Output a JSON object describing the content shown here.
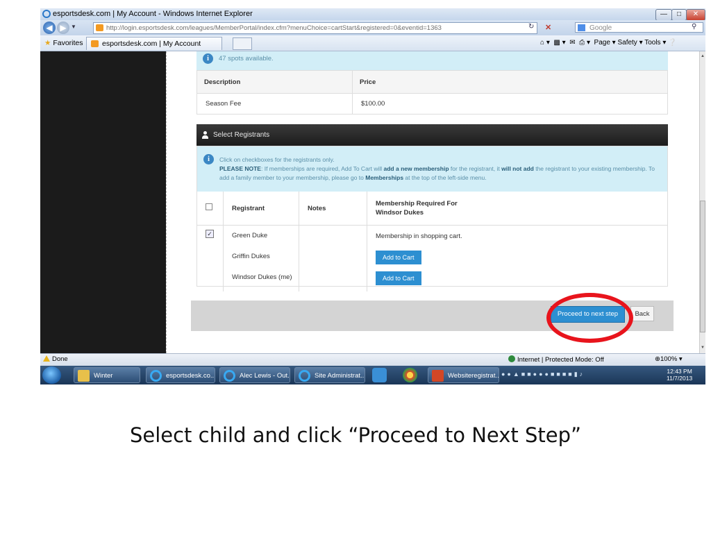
{
  "browser": {
    "title": "esportsdesk.com | My Account - Windows Internet Explorer",
    "url": "http://login.esportsdesk.com/leagues/MemberPortal/index.cfm?menuChoice=cartStart&registered=0&eventid=1363",
    "search_placeholder": "Google",
    "favorites_label": "Favorites",
    "tab_label": "esportsdesk.com | My Account",
    "command_bar": "Page ▾   Safety ▾   Tools ▾",
    "status_text": "Done",
    "zone_text": "Internet | Protected Mode: Off",
    "zoom_text": "100%"
  },
  "page": {
    "spots_text": "47 spots available.",
    "fee_table": {
      "headers": [
        "Description",
        "Price"
      ],
      "row": [
        "Season Fee",
        "$100.00"
      ]
    },
    "section_title": "Select Registrants",
    "instructions": {
      "line1": "Click on checkboxes for the registrants only.",
      "note_label": "PLEASE NOTE",
      "note_part1": ": If memberships are required, Add To Cart will ",
      "note_bold1": "add a new membership",
      "note_part2": " for the registrant, it ",
      "note_bold2": "will not add",
      "note_part3": " the registrant to your existing membership. To add a family member to your membership, please go to ",
      "note_bold3": "Memberships",
      "note_part4": " at the top of the left-side menu."
    },
    "reg_table": {
      "headers": {
        "registrant": "Registrant",
        "notes": "Notes",
        "membership_line1": "Membership Required For",
        "membership_line2": "Windsor Dukes"
      },
      "rows": [
        {
          "name": "Green Duke",
          "status": "Membership in shopping cart."
        },
        {
          "name": "Griffin Dukes",
          "button": "Add to Cart"
        },
        {
          "name": "Windsor Dukes (me)",
          "button": "Add to Cart"
        }
      ],
      "checked_mark": "✓"
    },
    "proceed_label": "Proceed to next step",
    "back_label": "Back"
  },
  "taskbar": {
    "items": [
      "Winter",
      "esportsdesk.co...",
      "Alec Lewis - Out...",
      "Site Administrat...",
      "Websiteregistrat..."
    ],
    "time": "12:43 PM",
    "date": "11/7/2013"
  },
  "caption": "Select child and click “Proceed to  Next Step”",
  "colors": {
    "accent": "#2d8fd1",
    "info_bg": "#d2eef7",
    "highlight": "#e8141c"
  }
}
